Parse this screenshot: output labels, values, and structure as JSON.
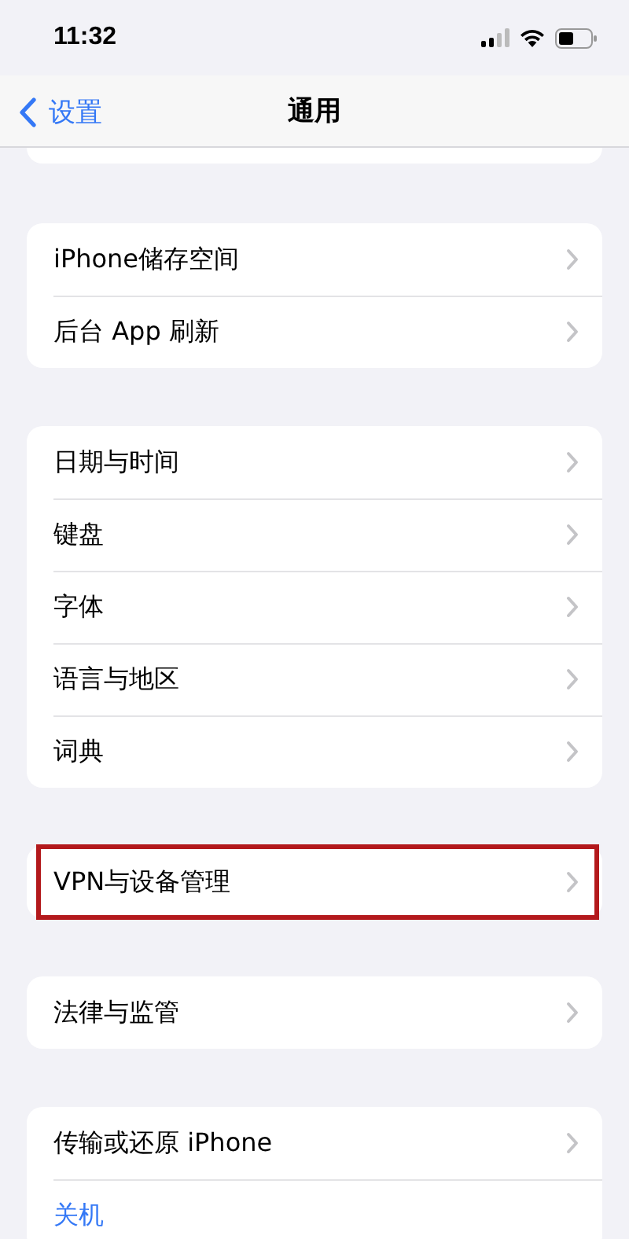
{
  "status_bar": {
    "time": "11:32"
  },
  "nav": {
    "back": "设置",
    "title": "通用"
  },
  "groups": [
    {
      "items": [
        {
          "label": "iPhone储存空间",
          "kind": "nav",
          "highlighted": false
        },
        {
          "label": "后台 App 刷新",
          "kind": "nav",
          "highlighted": false
        }
      ]
    },
    {
      "items": [
        {
          "label": "日期与时间",
          "kind": "nav",
          "highlighted": false
        },
        {
          "label": "键盘",
          "kind": "nav",
          "highlighted": false
        },
        {
          "label": "字体",
          "kind": "nav",
          "highlighted": false
        },
        {
          "label": "语言与地区",
          "kind": "nav",
          "highlighted": false
        },
        {
          "label": "词典",
          "kind": "nav",
          "highlighted": false
        }
      ]
    },
    {
      "items": [
        {
          "label": "VPN与设备管理",
          "kind": "nav",
          "highlighted": true
        }
      ]
    },
    {
      "items": [
        {
          "label": "法律与监管",
          "kind": "nav",
          "highlighted": false
        }
      ]
    },
    {
      "items": [
        {
          "label": "传输或还原 iPhone",
          "kind": "nav",
          "highlighted": false
        },
        {
          "label": "关机",
          "kind": "action",
          "highlighted": false
        }
      ]
    }
  ]
}
